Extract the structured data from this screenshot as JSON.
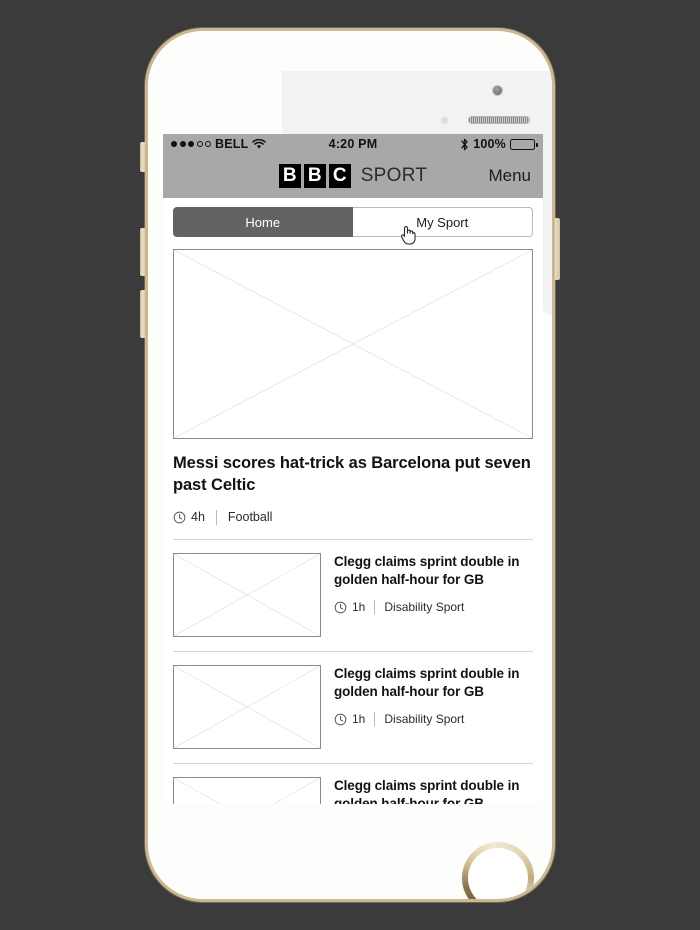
{
  "device": {
    "frame": "iphone-gold-white",
    "accent_gold": "#cdb894"
  },
  "status_bar": {
    "signal_dots_filled": 3,
    "signal_dots_empty": 2,
    "carrier": "BELL",
    "wifi_icon": "wifi-icon",
    "time": "4:20 PM",
    "bluetooth_icon": "bluetooth-icon",
    "battery_percent": "100%",
    "battery_level": 100
  },
  "app_header": {
    "logo_letters": [
      "B",
      "B",
      "C"
    ],
    "logo_word": "SPORT",
    "menu_label": "Menu",
    "background": "#a8a8a8"
  },
  "tabs": {
    "items": [
      {
        "label": "Home",
        "active": true
      },
      {
        "label": "My Sport",
        "active": false
      }
    ],
    "active_background": "#636363"
  },
  "cursor": {
    "type": "pointing-hand",
    "over": "My Sport"
  },
  "hero": {
    "image_placeholder": "image-placeholder",
    "title": "Messi scores hat-trick as Barcelona put seven past Celtic",
    "time_ago": "4h",
    "category": "Football",
    "clock_icon": "clock-icon"
  },
  "stories": [
    {
      "image_placeholder": "image-placeholder",
      "title": "Clegg claims sprint double in golden half-hour for GB",
      "time_ago": "1h",
      "category": "Disability Sport",
      "clock_icon": "clock-icon",
      "truncated": false
    },
    {
      "image_placeholder": "image-placeholder",
      "title": "Clegg claims sprint double in golden half-hour for GB",
      "time_ago": "1h",
      "category": "Disability Sport",
      "clock_icon": "clock-icon",
      "truncated": false
    },
    {
      "image_placeholder": "image-placeholder",
      "title": "Clegg claims sprint double in golden half-hour for GB",
      "time_ago": "",
      "category": "",
      "clock_icon": "clock-icon",
      "truncated": true
    }
  ]
}
